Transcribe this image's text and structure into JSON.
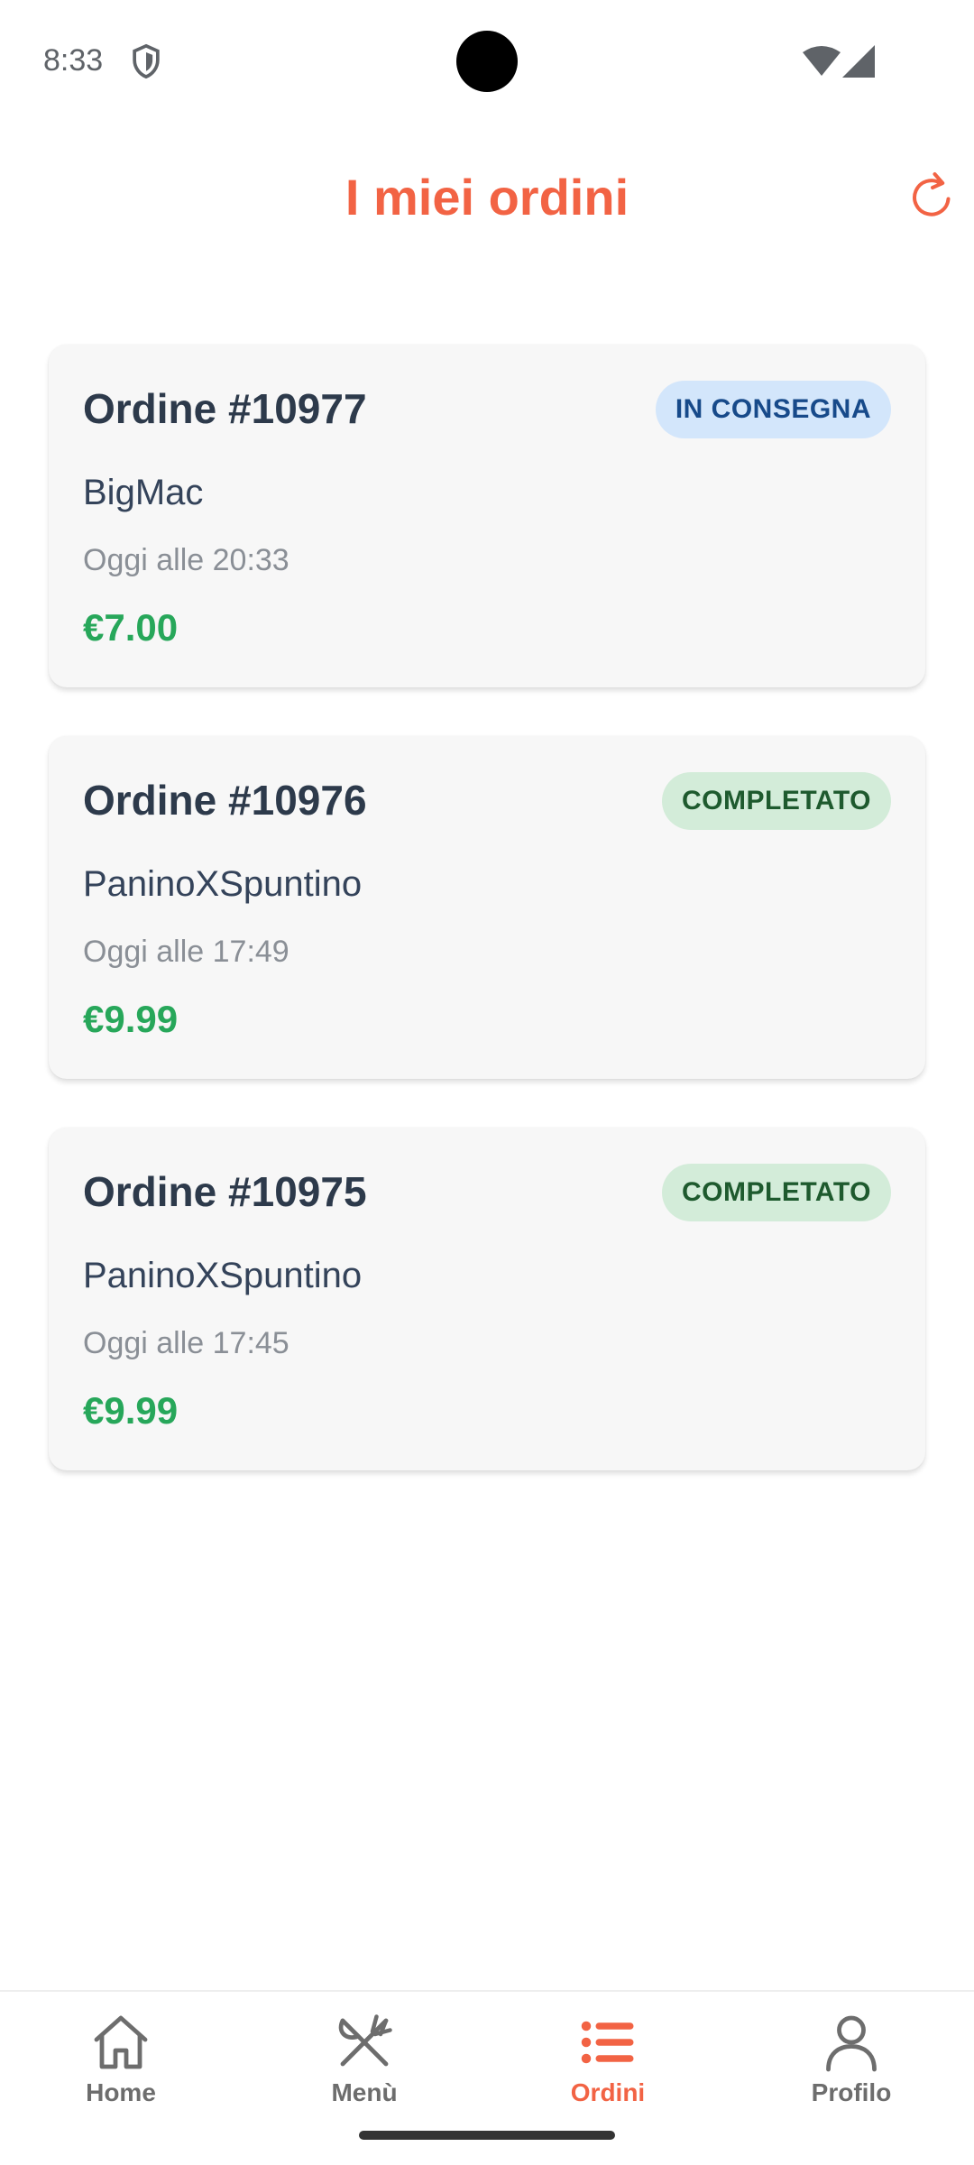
{
  "status_bar": {
    "time": "8:33",
    "icons": [
      "shield-icon",
      "wifi-icon",
      "signal-icon"
    ]
  },
  "header": {
    "title": "I miei ordini",
    "refresh_icon": "refresh-icon"
  },
  "orders": [
    {
      "number": "Ordine #10977",
      "status": "IN CONSEGNA",
      "status_color": "#174a8a",
      "status_bg": "#d3e6fb",
      "restaurant": "BigMac",
      "time": "Oggi alle 20:33",
      "price": "€7.00"
    },
    {
      "number": "Ordine #10976",
      "status": "COMPLETATO",
      "status_color": "#1e5a2e",
      "status_bg": "#d3ecd9",
      "restaurant": "PaninoXSpuntino",
      "time": "Oggi alle 17:49",
      "price": "€9.99"
    },
    {
      "number": "Ordine #10975",
      "status": "COMPLETATO",
      "status_color": "#1e5a2e",
      "status_bg": "#d3ecd9",
      "restaurant": "PaninoXSpuntino",
      "time": "Oggi alle 17:45",
      "price": "€9.99"
    }
  ],
  "bottom_nav": {
    "items": [
      {
        "label": "Home",
        "icon": "home-icon",
        "active": false
      },
      {
        "label": "Menù",
        "icon": "utensils-icon",
        "active": false
      },
      {
        "label": "Ordini",
        "icon": "list-icon",
        "active": true
      },
      {
        "label": "Profilo",
        "icon": "user-icon",
        "active": false
      }
    ]
  },
  "colors": {
    "accent": "#f26344",
    "price": "#27a75a",
    "title_text": "#2d3a4b"
  }
}
